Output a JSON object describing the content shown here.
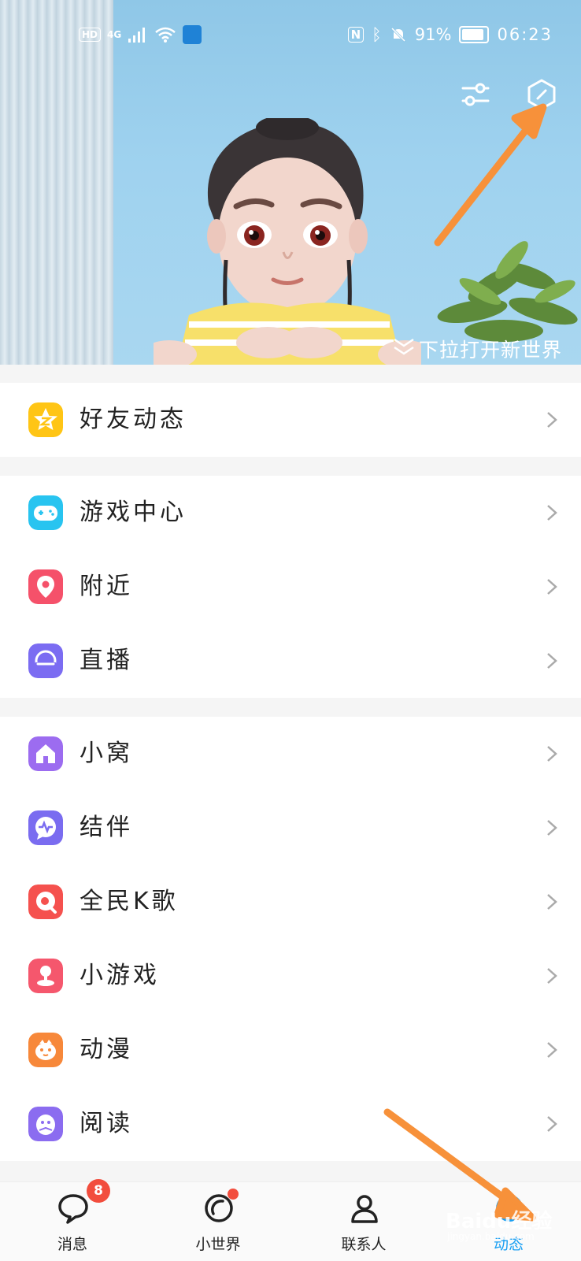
{
  "status_bar": {
    "hd": "HD",
    "network": "4G",
    "battery": "91%",
    "time": "06:23"
  },
  "hero": {
    "pull_text": "下拉打开新世界"
  },
  "groups": [
    [
      {
        "label": "好友动态",
        "icon": "star-icon",
        "color": "#ffc515"
      }
    ],
    [
      {
        "label": "游戏中心",
        "icon": "gamepad-icon",
        "color": "#28c4f0"
      },
      {
        "label": "附近",
        "icon": "location-pin-icon",
        "color": "#f5516a"
      },
      {
        "label": "直播",
        "icon": "live-icon",
        "color": "#7b6cf2"
      }
    ],
    [
      {
        "label": "小窝",
        "icon": "home-icon",
        "color": "#9c6cf0"
      },
      {
        "label": "结伴",
        "icon": "chat-pulse-icon",
        "color": "#7a6cf0"
      },
      {
        "label": "全民K歌",
        "icon": "karaoke-icon",
        "color": "#f5514e"
      },
      {
        "label": "小游戏",
        "icon": "joystick-icon",
        "color": "#f5576d"
      },
      {
        "label": "动漫",
        "icon": "anime-face-icon",
        "color": "#f7883a"
      },
      {
        "label": "阅读",
        "icon": "reading-penguin-icon",
        "color": "#8b6cf0"
      }
    ]
  ],
  "tabbar": {
    "tabs": [
      {
        "label": "消息",
        "badge": "8"
      },
      {
        "label": "小世界"
      },
      {
        "label": "联系人"
      },
      {
        "label": "动态"
      }
    ]
  },
  "watermark": {
    "text": "Baidu经验",
    "sub": "jingyan.baidu.com"
  },
  "colors": {
    "accent": "#1a9ff2",
    "annotation_arrow": "#f7913a",
    "badge": "#f24d3d"
  }
}
